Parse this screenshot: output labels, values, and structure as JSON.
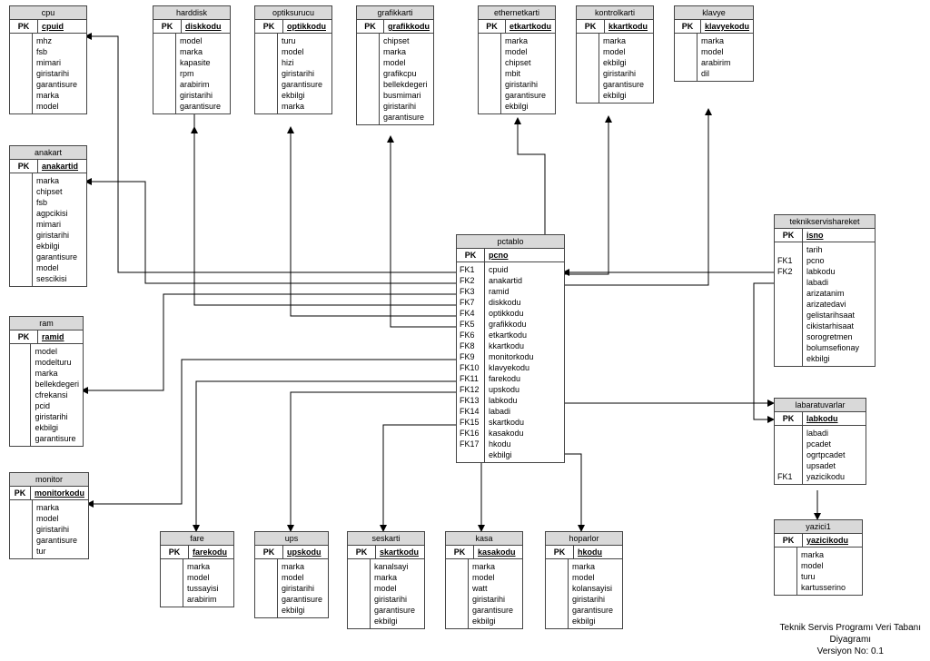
{
  "footer": {
    "l1": "Teknik Servis Programı Veri Tabanı",
    "l2": "Diyagramı",
    "l3": "Versiyon No: 0.1"
  },
  "pk_label": "PK",
  "tables": {
    "cpu": {
      "title": "cpu",
      "pk": "cpuid",
      "fields": [
        "mhz",
        "fsb",
        "mimari",
        "giristarihi",
        "garantisure",
        "marka",
        "model"
      ]
    },
    "anakart": {
      "title": "anakart",
      "pk": "anakartid",
      "fields": [
        "marka",
        "chipset",
        "fsb",
        "agpcikisi",
        "mimari",
        "giristarihi",
        "ekbilgi",
        "garantisure",
        "model",
        "sescikisi"
      ]
    },
    "ram": {
      "title": "ram",
      "pk": "ramid",
      "fields": [
        "model",
        "modelturu",
        "marka",
        "bellekdegeri",
        "cfrekansi",
        "pcid",
        "giristarihi",
        "ekbilgi",
        "garantisure"
      ]
    },
    "monitor": {
      "title": "monitor",
      "pk": "monitorkodu",
      "fields": [
        "marka",
        "model",
        "giristarihi",
        "garantisure",
        "tur"
      ]
    },
    "harddisk": {
      "title": "harddisk",
      "pk": "diskkodu",
      "fields": [
        "model",
        "marka",
        "kapasite",
        "rpm",
        "arabirim",
        "giristarihi",
        "garantisure"
      ]
    },
    "optiksurucu": {
      "title": "optiksurucu",
      "pk": "optikkodu",
      "fields": [
        "turu",
        "model",
        "hizi",
        "giristarihi",
        "garantisure",
        "ekbilgi",
        "marka"
      ]
    },
    "grafikkarti": {
      "title": "grafikkarti",
      "pk": "grafikkodu",
      "fields": [
        "chipset",
        "marka",
        "model",
        "grafikcpu",
        "bellekdegeri",
        "busmimari",
        "giristarihi",
        "garantisure"
      ]
    },
    "ethernetkarti": {
      "title": "ethernetkarti",
      "pk": "etkartkodu",
      "fields": [
        "marka",
        "model",
        "chipset",
        "mbit",
        "giristarihi",
        "garantisure",
        "ekbilgi"
      ]
    },
    "kontrolkarti": {
      "title": "kontrolkarti",
      "pk": "kkartkodu",
      "fields": [
        "marka",
        "model",
        "ekbilgi",
        "giristarihi",
        "garantisure",
        "ekbilgi"
      ]
    },
    "klavye": {
      "title": "klavye",
      "pk": "klavyekodu",
      "fields": [
        "marka",
        "model",
        "arabirim",
        "dil"
      ]
    },
    "fare": {
      "title": "fare",
      "pk": "farekodu",
      "fields": [
        "marka",
        "model",
        "tussayisi",
        "arabirim"
      ]
    },
    "ups": {
      "title": "ups",
      "pk": "upskodu",
      "fields": [
        "marka",
        "model",
        "giristarihi",
        "garantisure",
        "ekbilgi"
      ]
    },
    "seskarti": {
      "title": "seskarti",
      "pk": "skartkodu",
      "fields": [
        "kanalsayi",
        "marka",
        "model",
        "giristarihi",
        "garantisure",
        "ekbilgi"
      ]
    },
    "kasa": {
      "title": "kasa",
      "pk": "kasakodu",
      "fields": [
        "marka",
        "model",
        "watt",
        "giristarihi",
        "garantisure",
        "ekbilgi"
      ]
    },
    "hoparlor": {
      "title": "hoparlor",
      "pk": "hkodu",
      "fields": [
        "marka",
        "model",
        "kolansayisi",
        "giristarihi",
        "garantisure",
        "ekbilgi"
      ]
    },
    "teknik": {
      "title": "teknikservishareket",
      "pk": "isno",
      "fields": [
        "tarih",
        "pcno",
        "labkodu",
        "labadi",
        "arizatanim",
        "arizatedavi",
        "gelistarihsaat",
        "cikistarhisaat",
        "sorogretmen",
        "bolumsefionay",
        "ekbilgi"
      ],
      "fks": [
        "",
        "FK1",
        "FK2",
        "",
        "",
        "",
        "",
        "",
        "",
        "",
        ""
      ]
    },
    "lab": {
      "title": "labaratuvarlar",
      "pk": "labkodu",
      "fields": [
        "labadi",
        "pcadet",
        "ogrtpcadet",
        "upsadet",
        "yazicikodu"
      ],
      "fks": [
        "",
        "",
        "",
        "",
        "FK1"
      ]
    },
    "yazici": {
      "title": "yazici1",
      "pk": "yazicikodu",
      "fields": [
        "marka",
        "model",
        "turu",
        "kartusserino"
      ]
    },
    "pctablo": {
      "title": "pctablo",
      "pk": "pcno",
      "fks": [
        "FK1",
        "FK2",
        "FK3",
        "FK7",
        "FK4",
        "FK5",
        "FK6",
        "FK8",
        "FK9",
        "FK10",
        "FK11",
        "FK12",
        "FK13",
        "FK14",
        "FK15",
        "FK16",
        "FK17"
      ],
      "fields": [
        "cpuid",
        "anakartid",
        "ramid",
        "diskkodu",
        "optikkodu",
        "grafikkodu",
        "etkartkodu",
        "kkartkodu",
        "monitorkodu",
        "klavyekodu",
        "farekodu",
        "upskodu",
        "labkodu",
        "labadi",
        "skartkodu",
        "kasakodu",
        "hkodu",
        "ekbilgi"
      ]
    }
  }
}
